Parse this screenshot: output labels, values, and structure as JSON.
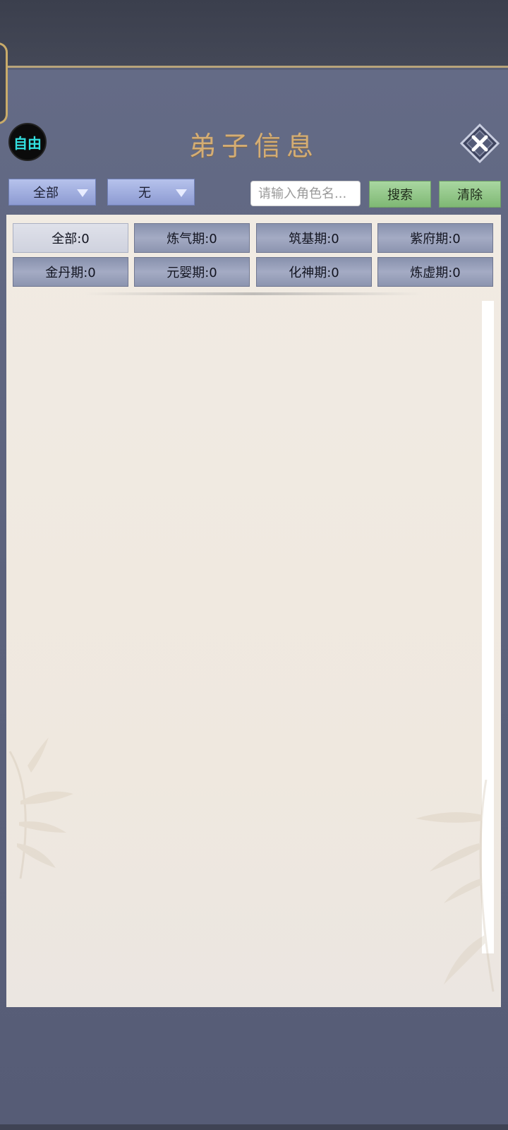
{
  "header": {
    "title": "弟子信息",
    "mode_badge": "自由",
    "close_icon": "close-x-icon"
  },
  "filters": {
    "category_dropdown": {
      "selected": "全部"
    },
    "sub_dropdown": {
      "selected": "无"
    },
    "search": {
      "placeholder": "请输入角色名...",
      "value": ""
    },
    "search_button": "搜索",
    "clear_button": "清除"
  },
  "tiers": [
    {
      "label": "全部:0",
      "active": true
    },
    {
      "label": "炼气期:0",
      "active": false
    },
    {
      "label": "筑基期:0",
      "active": false
    },
    {
      "label": "紫府期:0",
      "active": false
    },
    {
      "label": "金丹期:0",
      "active": false
    },
    {
      "label": "元婴期:0",
      "active": false
    },
    {
      "label": "化神期:0",
      "active": false
    },
    {
      "label": "炼虚期:0",
      "active": false
    }
  ],
  "colors": {
    "title": "#d4ad74",
    "badge_text": "#33e0e0",
    "green_button": "#8fc585",
    "dropdown": "#9aa7dc",
    "panel": "#f1ebe3"
  }
}
